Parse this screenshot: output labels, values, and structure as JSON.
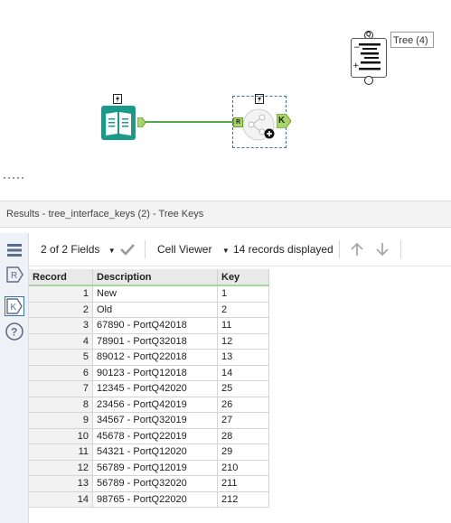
{
  "canvas": {
    "tree_tool": {
      "label": "Tree (4)",
      "top_anchor": "Q",
      "bottom_anchor": "Q"
    },
    "input_tool": {
      "icon": "book-input-icon"
    },
    "tree_interface_tool": {
      "anchor_in": "R",
      "anchor_out": "K"
    }
  },
  "results": {
    "title": "Results - tree_interface_keys (2) - Tree Keys",
    "fields_label": "2 of 2 Fields",
    "viewer_label": "Cell Viewer",
    "records_label": "14 records displayed",
    "side_tabs": [
      "list-icon",
      "R",
      "K",
      "?"
    ]
  },
  "table": {
    "headers": [
      "Record",
      "Description",
      "Key"
    ],
    "rows": [
      [
        "1",
        "New",
        "1"
      ],
      [
        "2",
        "Old",
        "2"
      ],
      [
        "3",
        "67890 - PortQ42018",
        "11"
      ],
      [
        "4",
        "78901 - PortQ32018",
        "12"
      ],
      [
        "5",
        "89012 - PortQ22018",
        "13"
      ],
      [
        "6",
        "90123 - PortQ12018",
        "14"
      ],
      [
        "7",
        "12345 - PortQ42020",
        "25"
      ],
      [
        "8",
        "23456 - PortQ42019",
        "26"
      ],
      [
        "9",
        "34567 - PortQ32019",
        "27"
      ],
      [
        "10",
        "45678 - PortQ22019",
        "28"
      ],
      [
        "11",
        "54321 - PortQ12020",
        "29"
      ],
      [
        "12",
        "56789 - PortQ12019",
        "210"
      ],
      [
        "13",
        "56789 - PortQ32020",
        "211"
      ],
      [
        "14",
        "98765 - PortQ22020",
        "212"
      ]
    ]
  },
  "colors": {
    "accent_teal": "#1a9b8a",
    "connector_green": "#55a84a",
    "anchor_green": "#a8d56a"
  }
}
